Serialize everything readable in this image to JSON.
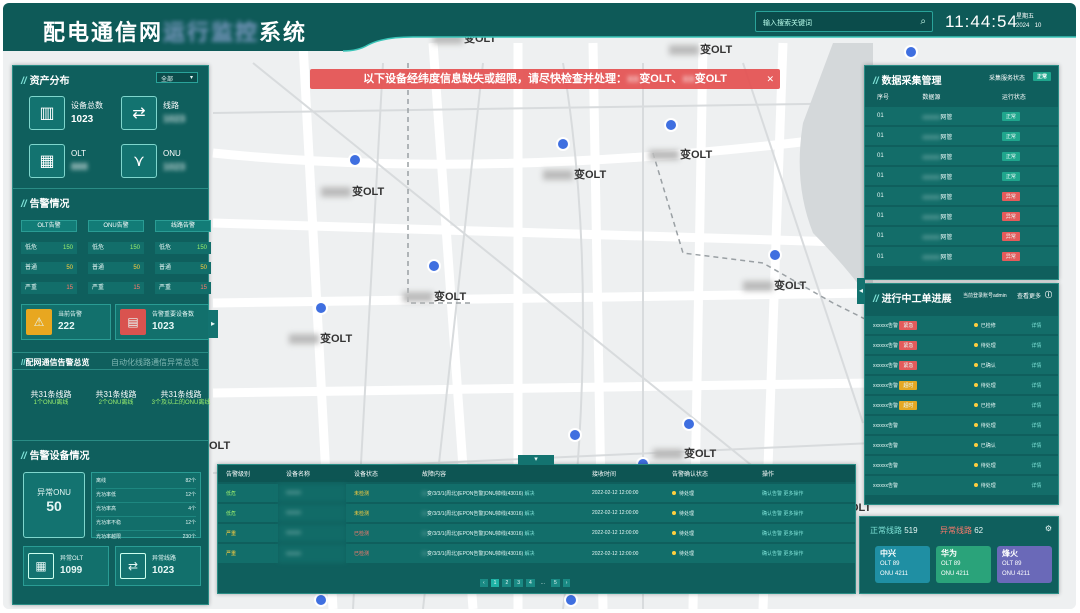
{
  "header": {
    "title_start": "配电通信网",
    "title_end": "系统",
    "search_placeholder": "输入搜索关键词",
    "time": "11:44:54",
    "weekday": "星期五",
    "date_year": "2024",
    "date_rest": "10"
  },
  "alert": {
    "text": "以下设备经纬度信息缺失或超限，请尽快检查并处理：",
    "item1": "变OLT、",
    "item2": "变OLT"
  },
  "map": {
    "labels": [
      "变OLT",
      "变OLT",
      "变OLT",
      "变OLT",
      "变OLT",
      "变OLT",
      "变OLT",
      "变OLT",
      "变OLT",
      "OLT",
      "变OLT"
    ]
  },
  "assets": {
    "title": "资产分布",
    "filter": "全部",
    "total_label": "设备总数",
    "total_value": "1023",
    "line_label": "线路",
    "olt_label": "OLT",
    "onu_label": "ONU"
  },
  "alarms": {
    "title": "告警情况",
    "tabs": [
      "OLT告警",
      "ONU告警",
      "线路告警"
    ],
    "rows": [
      {
        "label": "低危",
        "v": [
          "150",
          "150",
          "150"
        ]
      },
      {
        "label": "普通",
        "v": [
          "50",
          "50",
          "50"
        ]
      },
      {
        "label": "严重",
        "v": [
          "15",
          "15",
          "15"
        ]
      }
    ],
    "current_label": "当前告警",
    "current_value": "222",
    "sum_label": "告警重要设备数",
    "sum_value": "1023"
  },
  "summary": {
    "tab_active": "配网通信告警总览",
    "tab_other": "自动化线路通信异常总览",
    "items": [
      {
        "t": "共31条线路",
        "s": "1个ONU离线"
      },
      {
        "t": "共31条线路",
        "s": "2个ONU离线"
      },
      {
        "t": "共31条线路",
        "s": "3个及以上的ONU离线"
      }
    ]
  },
  "alarm_devices": {
    "title": "告警设备情况",
    "abn_onu_label": "异常ONU",
    "abn_onu_value": "50",
    "list": [
      {
        "k": "离线",
        "v": "82个"
      },
      {
        "k": "光功率低",
        "v": "12个"
      },
      {
        "k": "光功率高",
        "v": "4个"
      },
      {
        "k": "光功率不稳",
        "v": "12个"
      },
      {
        "k": "光功率越限",
        "v": "230个"
      }
    ],
    "abn_olt_label": "异常OLT",
    "abn_olt_value": "1099",
    "abn_line_label": "异常线路",
    "abn_line_value": "1023"
  },
  "collect": {
    "title": "数据采集管理",
    "status_label": "采集服务状态",
    "status_value": "正常",
    "cols": [
      "序号",
      "数据源",
      "运行状态"
    ],
    "rows": [
      {
        "n": "01",
        "src": "网管",
        "st": "正常",
        "c": "g"
      },
      {
        "n": "01",
        "src": "网管",
        "st": "正常",
        "c": "g"
      },
      {
        "n": "01",
        "src": "网管",
        "st": "正常",
        "c": "g"
      },
      {
        "n": "01",
        "src": "网管",
        "st": "正常",
        "c": "g"
      },
      {
        "n": "01",
        "src": "网管",
        "st": "异常",
        "c": "r"
      },
      {
        "n": "01",
        "src": "网管",
        "st": "异常",
        "c": "r"
      },
      {
        "n": "01",
        "src": "网管",
        "st": "异常",
        "c": "r"
      },
      {
        "n": "01",
        "src": "网管",
        "st": "异常",
        "c": "r"
      }
    ]
  },
  "workorders": {
    "title": "进行中工单进展",
    "user_label": "当前登录账号admin",
    "more": "查看更多",
    "rows": [
      {
        "a": "xxxxxx告警",
        "tag": "紧急",
        "tc": "r",
        "st": "已检修",
        "d": "详情"
      },
      {
        "a": "xxxxxx告警",
        "tag": "紧急",
        "tc": "r",
        "st": "待处理",
        "d": "详情"
      },
      {
        "a": "xxxxxx告警",
        "tag": "紧急",
        "tc": "r",
        "st": "已确认",
        "d": "详情"
      },
      {
        "a": "xxxxxx告警",
        "tag": "超时",
        "tc": "o",
        "st": "待处理",
        "d": "详情"
      },
      {
        "a": "xxxxxx告警",
        "tag": "超时",
        "tc": "o",
        "st": "已检修",
        "d": "详情"
      },
      {
        "a": "xxxxxx告警",
        "tag": "",
        "tc": "",
        "st": "待处理",
        "d": "详情"
      },
      {
        "a": "xxxxxx告警",
        "tag": "",
        "tc": "",
        "st": "已确认",
        "d": "详情"
      },
      {
        "a": "xxxxxx告警",
        "tag": "",
        "tc": "",
        "st": "待处理",
        "d": "详情"
      },
      {
        "a": "xxxxxx告警",
        "tag": "",
        "tc": "",
        "st": "待处理",
        "d": "详情"
      }
    ]
  },
  "lines": {
    "normal_label": "正常线路",
    "normal_value": "519",
    "abn_label": "异常线路",
    "abn_value": "62",
    "vendors": [
      {
        "name": "中兴",
        "olt": "89",
        "onu": "4211"
      },
      {
        "name": "华为",
        "olt": "89",
        "onu": "4211"
      },
      {
        "name": "烽火",
        "olt": "89",
        "onu": "4211"
      }
    ],
    "olt_label": "OLT",
    "onu_label": "ONU"
  },
  "bottom": {
    "cols": [
      "告警级别",
      "设备名称",
      "设备状态",
      "故障内容",
      "接收时间",
      "告警确认状态",
      "操作"
    ],
    "rows": [
      {
        "lvl": "低危",
        "lc": "g",
        "st": "未检测",
        "sc": "o",
        "content": "变/3/3/1(周北)[EPON告警]ONU掉线(43016)",
        "fix": "解决",
        "time": "2022-02-12 12:00:00",
        "ack": "待处理",
        "op1": "确认告警",
        "op2": "更多操作"
      },
      {
        "lvl": "低危",
        "lc": "g",
        "st": "未检测",
        "sc": "o",
        "content": "变/3/3/1(周北)[EPON告警]ONU掉线(43016)",
        "fix": "解决",
        "time": "2022-02-12 12:00:00",
        "ack": "待处理",
        "op1": "确认告警",
        "op2": "更多操作"
      },
      {
        "lvl": "严重",
        "lc": "r",
        "st": "已检测",
        "sc": "r",
        "content": "变/3/3/1(周北)[EPON告警]ONU掉线(43016)",
        "fix": "解决",
        "time": "2022-02-12 12:00:00",
        "ack": "待处理",
        "op1": "确认告警",
        "op2": "更多操作"
      },
      {
        "lvl": "严重",
        "lc": "r",
        "st": "已检测",
        "sc": "r",
        "content": "变/3/3/1(周北)[EPON告警]ONU掉线(43016)",
        "fix": "解决",
        "time": "2022-02-12 12:00:00",
        "ack": "待处理",
        "op1": "确认告警",
        "op2": "更多操作"
      }
    ],
    "pages": [
      "1",
      "2",
      "3",
      "4",
      "...",
      "5"
    ]
  }
}
